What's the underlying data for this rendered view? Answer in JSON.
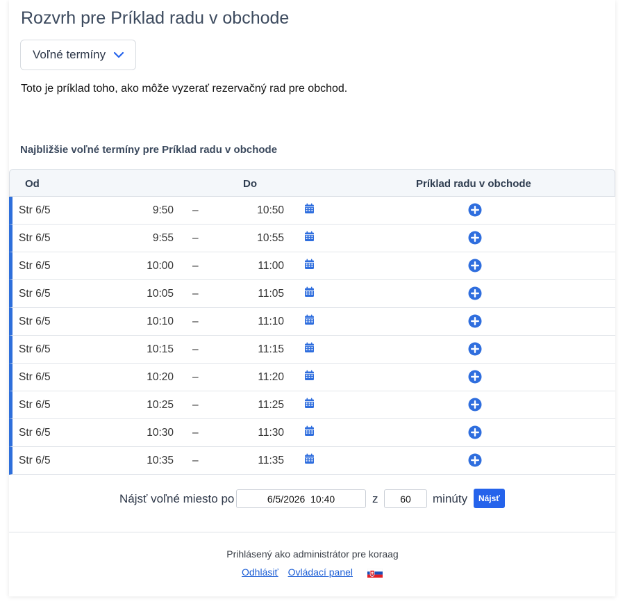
{
  "page": {
    "title": "Rozvrh pre Príklad radu v obchode",
    "dropdown_label": "Voľné termíny",
    "intro_text": "Toto je príklad toho, ako môže vyzerať rezervačný rad pre obchod.",
    "section_title": "Najbližšie voľné termíny pre Príklad radu v obchode"
  },
  "table": {
    "headers": {
      "from": "Od",
      "to": "Do",
      "queue": "Príklad radu v obchode"
    },
    "rows": [
      {
        "day": "Str 6/5",
        "from": "9:50",
        "dash": "–",
        "to": "10:50"
      },
      {
        "day": "Str 6/5",
        "from": "9:55",
        "dash": "–",
        "to": "10:55"
      },
      {
        "day": "Str 6/5",
        "from": "10:00",
        "dash": "–",
        "to": "11:00"
      },
      {
        "day": "Str 6/5",
        "from": "10:05",
        "dash": "–",
        "to": "11:05"
      },
      {
        "day": "Str 6/5",
        "from": "10:10",
        "dash": "–",
        "to": "11:10"
      },
      {
        "day": "Str 6/5",
        "from": "10:15",
        "dash": "–",
        "to": "11:15"
      },
      {
        "day": "Str 6/5",
        "from": "10:20",
        "dash": "–",
        "to": "11:20"
      },
      {
        "day": "Str 6/5",
        "from": "10:25",
        "dash": "–",
        "to": "11:25"
      },
      {
        "day": "Str 6/5",
        "from": "10:30",
        "dash": "–",
        "to": "11:30"
      },
      {
        "day": "Str 6/5",
        "from": "10:35",
        "dash": "–",
        "to": "11:35"
      }
    ]
  },
  "finder": {
    "label": "Nájsť voľné miesto po",
    "datetime_value": "6/5/2026  10:40",
    "sep": "z",
    "minutes_value": "60",
    "minutes_label": "minúty",
    "button_label": "Nájsť"
  },
  "footer": {
    "logged_in_text": "Prihlásený ako administrátor pre koraag",
    "logout_label": "Odhlásiť",
    "panel_label": "Ovládací panel",
    "language_flag": "slovakia-flag-icon"
  },
  "colors": {
    "accent": "#2563eb",
    "row_marker": "#2e6fdb",
    "title": "#3c4a5e",
    "header_bg": "#f4f7fa"
  },
  "icons": {
    "dropdown": "chevron-down-icon",
    "calendar": "calendar-icon",
    "add": "plus-circle-icon"
  }
}
